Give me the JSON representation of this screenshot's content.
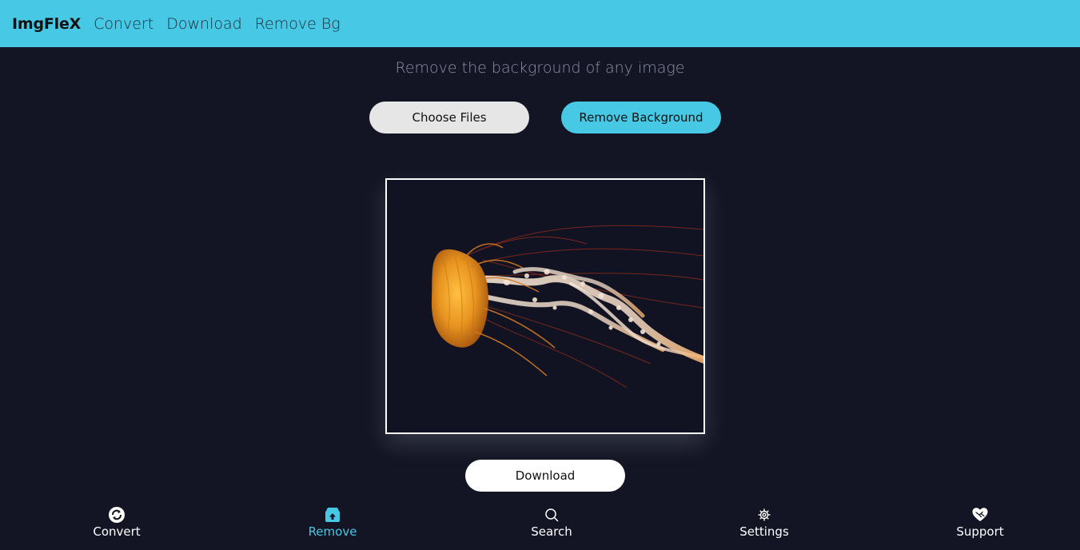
{
  "navbar": {
    "brand": "ImgFleX",
    "links": [
      "Convert",
      "Download",
      "Remove Bg"
    ]
  },
  "main": {
    "subtitle": "Remove the background of any image",
    "choose_files_label": "Choose Files",
    "remove_background_label": "Remove Background",
    "download_label": "Download"
  },
  "bottom_nav": {
    "items": [
      {
        "label": "Convert",
        "icon": "convert-icon",
        "active": false
      },
      {
        "label": "Remove",
        "icon": "remove-icon",
        "active": true
      },
      {
        "label": "Search",
        "icon": "search-icon",
        "active": false
      },
      {
        "label": "Settings",
        "icon": "gear-icon",
        "active": false
      },
      {
        "label": "Support",
        "icon": "heart-handshake-icon",
        "active": false
      }
    ]
  },
  "colors": {
    "accent": "#47c8e4",
    "background": "#131524",
    "muted_text": "#8d91a6"
  }
}
